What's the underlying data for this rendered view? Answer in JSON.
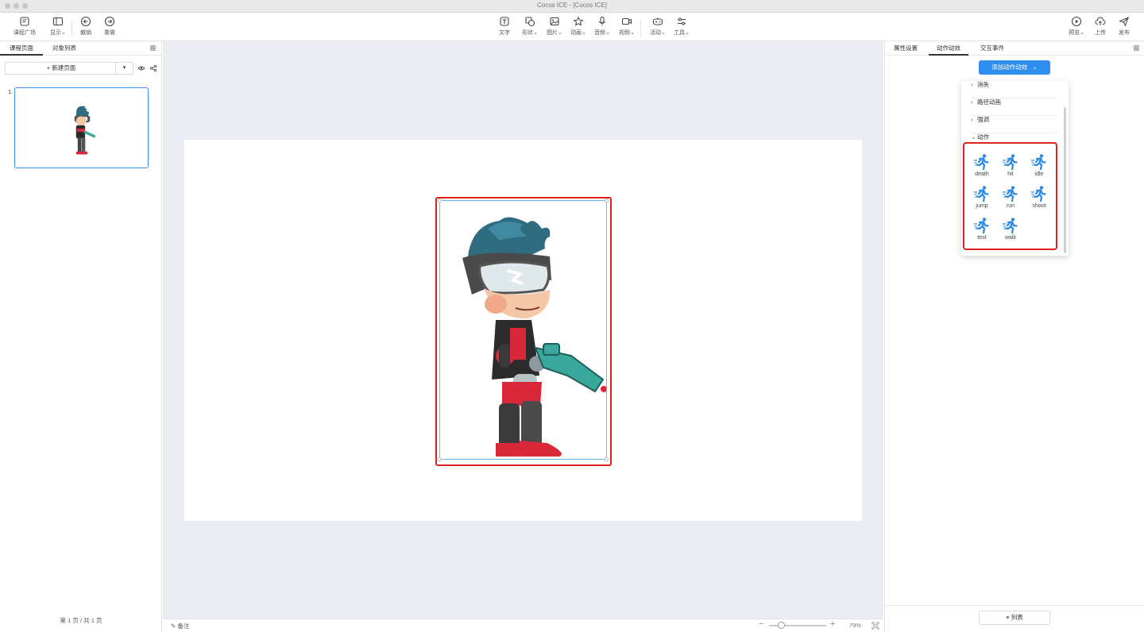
{
  "window": {
    "title": "Cocos ICE - [Cocos ICE]"
  },
  "toolbar": {
    "course_square": "课程广场",
    "display": "显示",
    "undo": "撤销",
    "redo": "重做",
    "text": "文字",
    "shape": "形状",
    "image": "图片",
    "animation": "动画",
    "audio": "音频",
    "video": "视频",
    "activity": "活动",
    "tools": "工具",
    "preview": "预览",
    "upload": "上传",
    "publish": "发布"
  },
  "left_panel": {
    "tabs": [
      "课程页面",
      "对象列表"
    ],
    "new_page": "+ 新建页面",
    "page_number": "1.",
    "page_info": "第 1 页 / 共 1 页"
  },
  "status_bar": {
    "note": "备注",
    "zoom_value": "79%",
    "zoom_minus": "−",
    "zoom_plus": "+",
    "zoom_level": 0.79
  },
  "right_panel": {
    "tabs": [
      "属性设置",
      "动作动效",
      "交互事件"
    ],
    "add_button": "添加动作动效",
    "dropdown": {
      "categories": [
        {
          "label": "消失",
          "expanded": false
        },
        {
          "label": "路径动画",
          "expanded": false
        },
        {
          "label": "强调",
          "expanded": false
        },
        {
          "label": "动作",
          "expanded": true
        }
      ],
      "actions": [
        "death",
        "hit",
        "idle",
        "jump",
        "run",
        "shoot",
        "test",
        "walk"
      ]
    },
    "list_button": "≡ 列表"
  },
  "colors": {
    "accent": "#2f8ef0",
    "highlight": "#e0211b",
    "selection": "#6ab5ec"
  }
}
